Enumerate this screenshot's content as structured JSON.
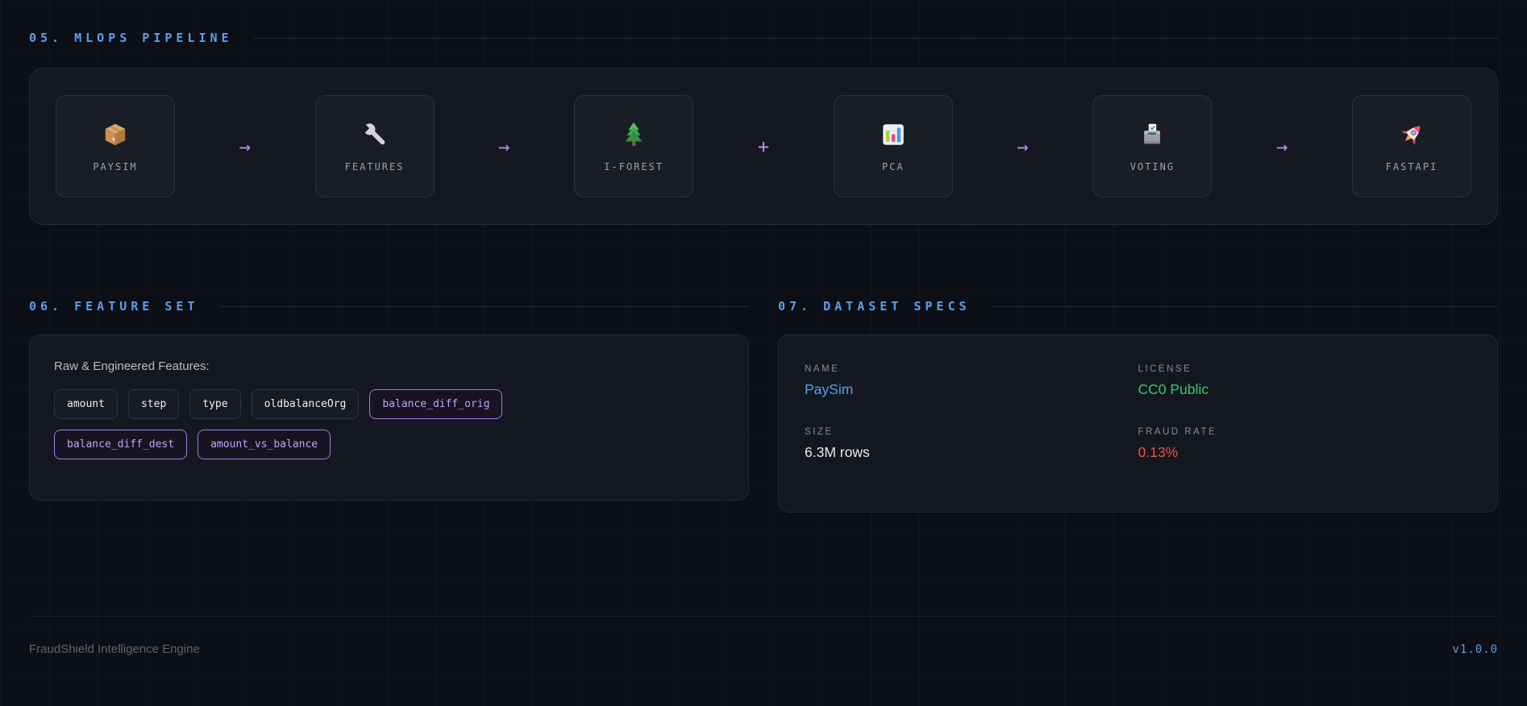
{
  "pipeline": {
    "title": "05. MLOPS PIPELINE",
    "stages": [
      {
        "label": "PAYSIM",
        "icon": "package-icon"
      },
      {
        "label": "FEATURES",
        "icon": "wrench-icon"
      },
      {
        "label": "I-FOREST",
        "icon": "evergreen-tree-icon"
      },
      {
        "label": "PCA",
        "icon": "bar-chart-icon"
      },
      {
        "label": "VOTING",
        "icon": "ballot-box-icon"
      },
      {
        "label": "FASTAPI",
        "icon": "rocket-icon"
      }
    ],
    "connectors": [
      "→",
      "→",
      "+",
      "→",
      "→"
    ]
  },
  "feature_set": {
    "title": "06. FEATURE SET",
    "intro": "Raw & Engineered Features:",
    "features": [
      {
        "label": "amount",
        "engineered": false
      },
      {
        "label": "step",
        "engineered": false
      },
      {
        "label": "type",
        "engineered": false
      },
      {
        "label": "oldbalanceOrg",
        "engineered": false
      },
      {
        "label": "balance_diff_orig",
        "engineered": true
      },
      {
        "label": "balance_diff_dest",
        "engineered": true
      },
      {
        "label": "amount_vs_balance",
        "engineered": true
      }
    ]
  },
  "dataset_specs": {
    "title": "07. DATASET SPECS",
    "specs": [
      {
        "label": "NAME",
        "value": "PaySim"
      },
      {
        "label": "LICENSE",
        "value": "CC0 Public"
      },
      {
        "label": "SIZE",
        "value": "6.3M rows"
      },
      {
        "label": "FRAUD RATE",
        "value": "0.13%"
      }
    ]
  },
  "footer": {
    "product": "FraudShield Intelligence Engine",
    "version": "v1.0.0"
  },
  "colors": {
    "background": "#0c0f15",
    "panel": "#14171f",
    "card": "#191d26",
    "accent_blue": "#58a0f0",
    "accent_purple": "#b98af2",
    "chip_purple_border": "#9b7ce8",
    "chip_purple_text": "#c2a3f6",
    "green": "#3ec46d",
    "red": "#e5534e",
    "muted_text": "#9aa1ac"
  }
}
